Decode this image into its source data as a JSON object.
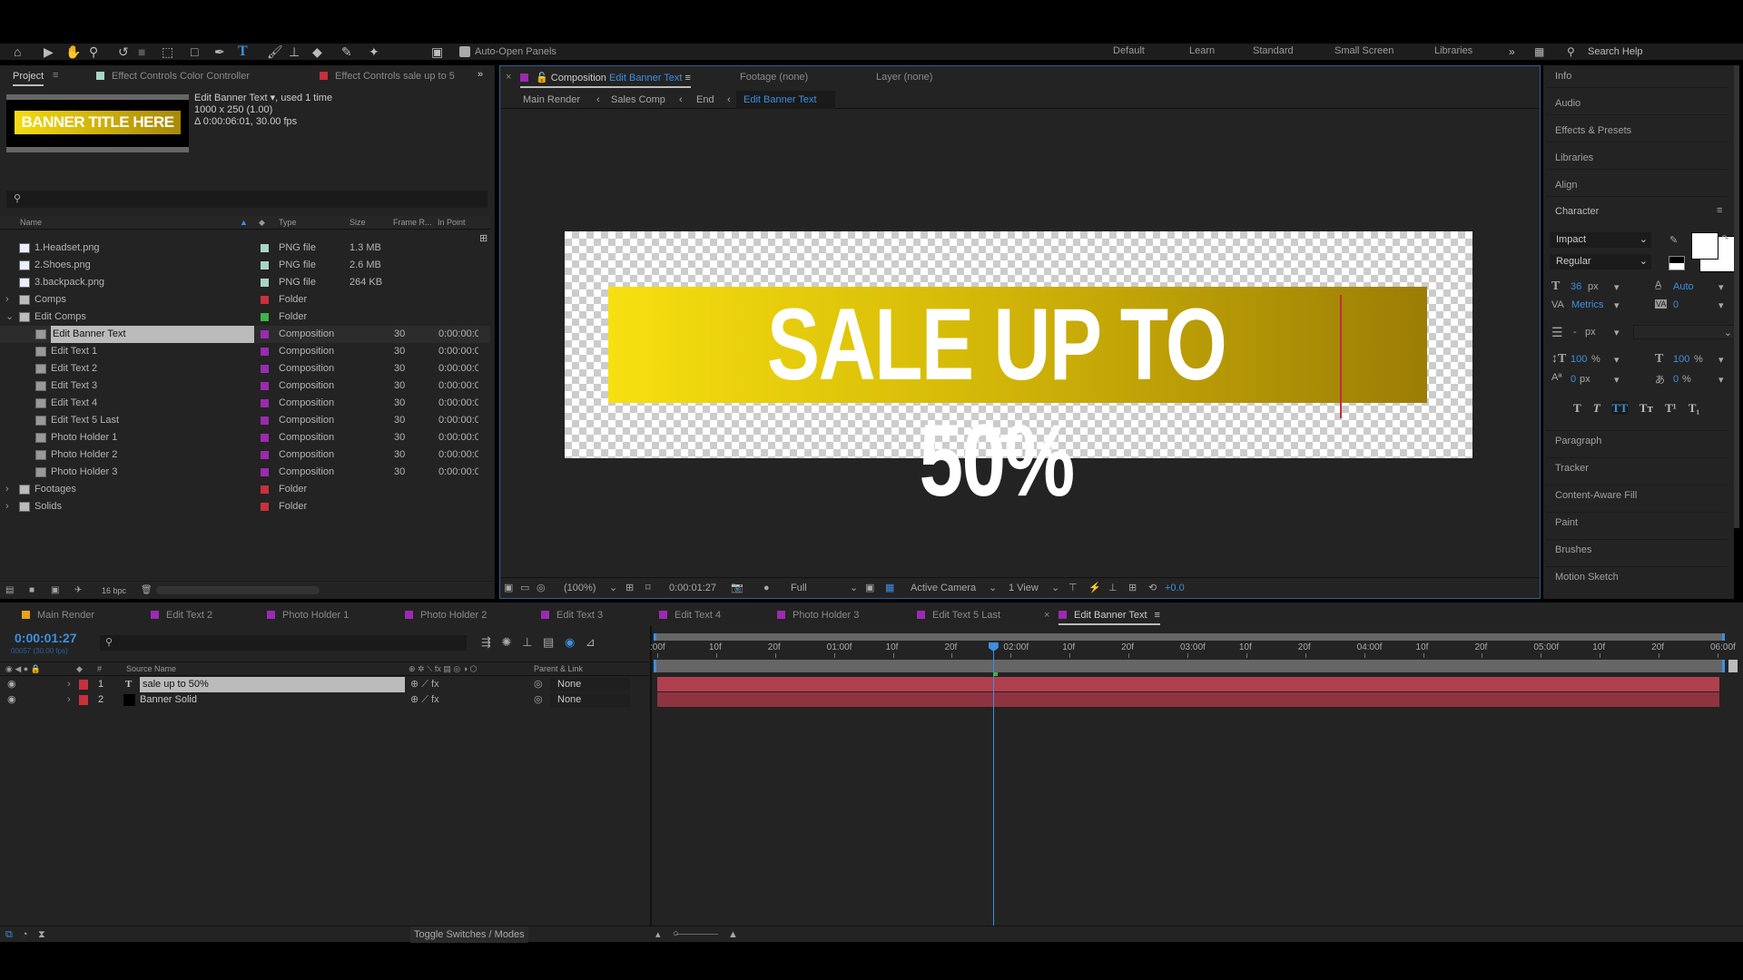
{
  "toolbar": {
    "auto_open_label": "Auto-Open Panels",
    "workspaces": [
      "Default",
      "Learn",
      "Standard",
      "Small Screen",
      "Libraries"
    ],
    "search_help": "Search Help"
  },
  "project": {
    "tabs": [
      "Project",
      "Effect Controls Color Controller",
      "Effect Controls sale up to 5"
    ],
    "thumb_text": "BANNER TITLE HERE",
    "selected_name": "Edit Banner Text",
    "used": ", used 1 time",
    "dims": "1000 x 250 (1.00)",
    "duration": "Δ 0:00:06:01, 30.00 fps",
    "columns": [
      "Name",
      "Type",
      "Size",
      "Frame R...",
      "In Point"
    ],
    "items": [
      {
        "name": "1.Headset.png",
        "type": "PNG file",
        "size": "1.3 MB",
        "fr": "",
        "in": "",
        "kind": "file",
        "label": "#a8d5c8",
        "indent": 0
      },
      {
        "name": "2.Shoes.png",
        "type": "PNG file",
        "size": "2.6 MB",
        "fr": "",
        "in": "",
        "kind": "file",
        "label": "#a8d5c8",
        "indent": 0
      },
      {
        "name": "3.backpack.png",
        "type": "PNG file",
        "size": "264 KB",
        "fr": "",
        "in": "",
        "kind": "file",
        "label": "#a8d5c8",
        "indent": 0
      },
      {
        "name": "Comps",
        "type": "Folder",
        "size": "",
        "fr": "",
        "in": "",
        "kind": "folder",
        "label": "#c8303c",
        "indent": 0,
        "arrow": "›"
      },
      {
        "name": "Edit Comps",
        "type": "Folder",
        "size": "",
        "fr": "",
        "in": "",
        "kind": "folder",
        "label": "#3db34a",
        "indent": 0,
        "arrow": "⌄"
      },
      {
        "name": "Edit Banner Text",
        "type": "Composition",
        "size": "",
        "fr": "30",
        "in": "0:00:00:0",
        "kind": "comp",
        "label": "#9a2ab0",
        "indent": 1,
        "selected": true
      },
      {
        "name": "Edit Text 1",
        "type": "Composition",
        "size": "",
        "fr": "30",
        "in": "0:00:00:0",
        "kind": "comp",
        "label": "#9a2ab0",
        "indent": 1
      },
      {
        "name": "Edit Text 2",
        "type": "Composition",
        "size": "",
        "fr": "30",
        "in": "0:00:00:0",
        "kind": "comp",
        "label": "#9a2ab0",
        "indent": 1
      },
      {
        "name": "Edit Text 3",
        "type": "Composition",
        "size": "",
        "fr": "30",
        "in": "0:00:00:0",
        "kind": "comp",
        "label": "#9a2ab0",
        "indent": 1
      },
      {
        "name": "Edit Text 4",
        "type": "Composition",
        "size": "",
        "fr": "30",
        "in": "0:00:00:0",
        "kind": "comp",
        "label": "#9a2ab0",
        "indent": 1
      },
      {
        "name": "Edit Text 5 Last",
        "type": "Composition",
        "size": "",
        "fr": "30",
        "in": "0:00:00:0",
        "kind": "comp",
        "label": "#9a2ab0",
        "indent": 1
      },
      {
        "name": "Photo Holder 1",
        "type": "Composition",
        "size": "",
        "fr": "30",
        "in": "0:00:00:0",
        "kind": "comp",
        "label": "#9a2ab0",
        "indent": 1
      },
      {
        "name": "Photo Holder 2",
        "type": "Composition",
        "size": "",
        "fr": "30",
        "in": "0:00:00:0",
        "kind": "comp",
        "label": "#9a2ab0",
        "indent": 1
      },
      {
        "name": "Photo Holder 3",
        "type": "Composition",
        "size": "",
        "fr": "30",
        "in": "0:00:00:0",
        "kind": "comp",
        "label": "#9a2ab0",
        "indent": 1
      },
      {
        "name": "Footages",
        "type": "Folder",
        "size": "",
        "fr": "",
        "in": "",
        "kind": "folder",
        "label": "#c8303c",
        "indent": 0,
        "arrow": "›"
      },
      {
        "name": "Solids",
        "type": "Folder",
        "size": "",
        "fr": "",
        "in": "",
        "kind": "folder",
        "label": "#c8303c",
        "indent": 0,
        "arrow": "›"
      }
    ],
    "bpc": "16 bpc"
  },
  "comp": {
    "tab_prefix": "Composition",
    "tab_name": "Edit Banner Text",
    "footage": "Footage (none)",
    "layer": "Layer (none)",
    "breadcrumb": [
      "Main Render",
      "Sales Comp",
      "End",
      "Edit Banner Text"
    ],
    "banner_text": "SALE UP TO 50%",
    "zoom": "(100%)",
    "time": "0:00:01:27",
    "resolution": "Full",
    "camera": "Active Camera",
    "views": "1 View",
    "exposure": "+0.0"
  },
  "right_panels": {
    "top": [
      "Info",
      "Audio",
      "Effects & Presets",
      "Libraries",
      "Align"
    ],
    "character": {
      "title": "Character",
      "font": "Impact",
      "style": "Regular",
      "size": "36",
      "size_unit": "px",
      "leading": "Auto",
      "kerning": "Metrics",
      "tracking": "0",
      "stroke": "-",
      "stroke_unit": "px",
      "vscale": "100",
      "hscale": "100",
      "baseline": "0",
      "baseline_unit": "px",
      "tsume": "0",
      "pct": "%"
    },
    "bottom": [
      "Paragraph",
      "Tracker",
      "Content-Aware Fill",
      "Paint",
      "Brushes",
      "Motion Sketch"
    ]
  },
  "timeline": {
    "tabs": [
      {
        "name": "Main Render",
        "color": "#e8a020"
      },
      {
        "name": "Edit Text 2",
        "color": "#9a2ab0"
      },
      {
        "name": "Photo Holder 1",
        "color": "#9a2ab0"
      },
      {
        "name": "Photo Holder 2",
        "color": "#9a2ab0"
      },
      {
        "name": "Edit Text 3",
        "color": "#9a2ab0"
      },
      {
        "name": "Edit Text 4",
        "color": "#9a2ab0"
      },
      {
        "name": "Photo Holder 3",
        "color": "#9a2ab0"
      },
      {
        "name": "Edit Text 5 Last",
        "color": "#9a2ab0"
      },
      {
        "name": "Edit Banner Text",
        "color": "#9a2ab0",
        "active": true
      }
    ],
    "current_time": "0:00:01:27",
    "frame_info": "00057 (30.00 fps)",
    "col_source": "Source Name",
    "col_parent": "Parent & Link",
    "layers": [
      {
        "num": "1",
        "type": "T",
        "name": "sale up to 50%",
        "parent": "None",
        "color": "#c8303c"
      },
      {
        "num": "2",
        "type": "solid",
        "name": "Banner Solid",
        "parent": "None",
        "color": "#c8303c"
      }
    ],
    "ticks": [
      ":00f",
      "10f",
      "20f",
      "01:00f",
      "10f",
      "20f",
      "02:00f",
      "10f",
      "20f",
      "03:00f",
      "10f",
      "20f",
      "04:00f",
      "10f",
      "20f",
      "05:00f",
      "10f",
      "20f",
      "06:00f"
    ],
    "playhead_frame": 57,
    "total_frames": 181,
    "toggle_label": "Toggle Switches / Modes"
  },
  "colors": {
    "accent": "#3d8fe0",
    "layer_bar": "#b0404e",
    "banner_start": "#f5dc10",
    "banner_end": "#9c7d05"
  }
}
